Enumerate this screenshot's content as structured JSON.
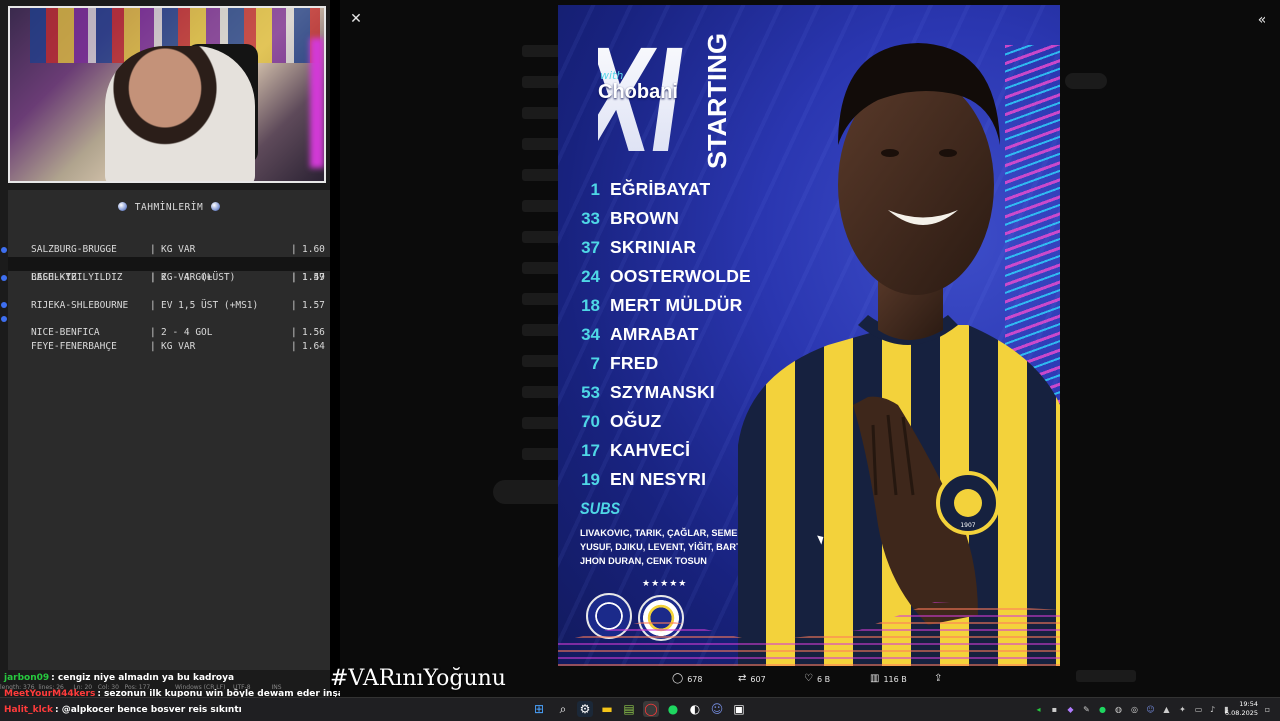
{
  "bets": {
    "title": "TAHMİNLERİM",
    "rows": [
      {
        "match": "SALZBURG-BRUGGE",
        "pick": "KG VAR",
        "odds": "1.60",
        "dot": false
      },
      {
        "match": "BASEL-YB",
        "pick": "KG VAR (+ÜST)",
        "odds": "1.47",
        "dot": true
      },
      {
        "match": "LECH-KIZILYILDIZ",
        "pick": "2 - 4 GOL",
        "odds": "1.59",
        "dot": false
      },
      {
        "match": "RIJEKA-SHLEBOURNE",
        "pick": "EV 1,5 ÜST (+MS1)",
        "odds": "1.57",
        "dot": true
      },
      {
        "match": "NICE-BENFICA",
        "pick": "2 - 4 GOL",
        "odds": "1.56",
        "dot": true
      },
      {
        "match": "FEYE-FENERBAHÇE",
        "pick": "KG VAR",
        "odds": "1.64",
        "dot": true
      }
    ]
  },
  "editor_status": "length: 376  lines: 26     Ln: 20   Col: 30   Pos: 177             Windows (CR LF)    UTF-8           INS",
  "chat": [
    {
      "user": "jarbon09",
      "color": "#27c93f",
      "message": ": cengiz niye almadın ya bu kadroya"
    },
    {
      "user": "MeetYourM44kers",
      "color": "#ff3b3b",
      "message": ": sezonun ilk kuponu win böyle dewam eder inşallah."
    },
    {
      "user": "Halit_klck",
      "color": "#ff3b3b",
      "message": ": @alpkocer bence bosver reis sıkıntı"
    }
  ],
  "hashtag": "#VARınıYoğunu",
  "modal": {
    "close_icon": "✕",
    "expand_icon": "«"
  },
  "poster": {
    "big_letter": "XI",
    "sponsor_with": "with",
    "sponsor_name": "Chobani",
    "starting_word": "STARTING",
    "lineup": [
      {
        "num": "1",
        "name": "EĞRİBAYAT"
      },
      {
        "num": "33",
        "name": "BROWN"
      },
      {
        "num": "37",
        "name": "SKRINIAR"
      },
      {
        "num": "24",
        "name": "OOSTERWOLDE"
      },
      {
        "num": "18",
        "name": "MERT MÜLDÜR"
      },
      {
        "num": "34",
        "name": "AMRABAT"
      },
      {
        "num": "7",
        "name": "FRED"
      },
      {
        "num": "53",
        "name": "SZYMANSKI"
      },
      {
        "num": "70",
        "name": "OĞUZ"
      },
      {
        "num": "17",
        "name": "KAHVECİ"
      },
      {
        "num": "19",
        "name": "EN NESYRI"
      }
    ],
    "subs_title": "SUBS",
    "subs_lines": [
      "LIVAKOVIC, TARIK, ÇAĞLAR, SEMEDO,",
      "YUSUF, DJIKU, LEVENT, YİĞİT, BARTUĞ,",
      "JHON DURAN, CENK TOSUN"
    ],
    "crest_stars": "★★★★★",
    "badge_text": "FENERBAHÇE SPOR KULÜBÜ 1907",
    "badge_year": "1907"
  },
  "actions": {
    "replies": "678",
    "reposts": "607",
    "likes": "6 B",
    "views": "116 B"
  },
  "taskbar": {
    "clock_time": "19:54",
    "clock_date": "6.08.2025"
  },
  "colors": {
    "accent_cyan": "#4fd7e6",
    "poster_blue": "#2a36b0",
    "fb_yellow": "#f2d23a",
    "fb_navy": "#1b2a8a"
  }
}
